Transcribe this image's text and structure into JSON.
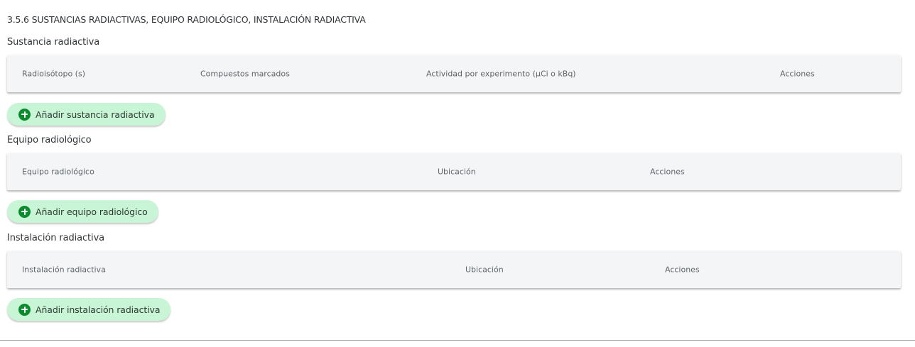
{
  "section_title": "3.5.6 SUSTANCIAS RADIACTIVAS, EQUIPO RADIOLÓGICO, INSTALACIÓN RADIACTIVA",
  "substances": {
    "heading": "Sustancia radiactiva",
    "columns": [
      "Radioisótopo (s)",
      "Compuestos marcados",
      "Actividad por experimento (µCi o kBq)",
      "Acciones"
    ],
    "add_label": "Añadir sustancia radiactiva"
  },
  "equipment": {
    "heading": "Equipo radiológico",
    "columns": [
      "Equipo radiológico",
      "Ubicación",
      "Acciones"
    ],
    "add_label": "Añadir equipo radiológico"
  },
  "installation": {
    "heading": "Instalación radiactiva",
    "columns": [
      "Instalación radiactiva",
      "Ubicación",
      "Acciones"
    ],
    "add_label": "Añadir instalación radiactiva"
  },
  "colors": {
    "button_bg": "#c9f5d7",
    "icon_green": "#0c8a2e",
    "table_header_bg": "#f3f5f7"
  },
  "icons": {
    "add": "plus-circle-icon"
  }
}
